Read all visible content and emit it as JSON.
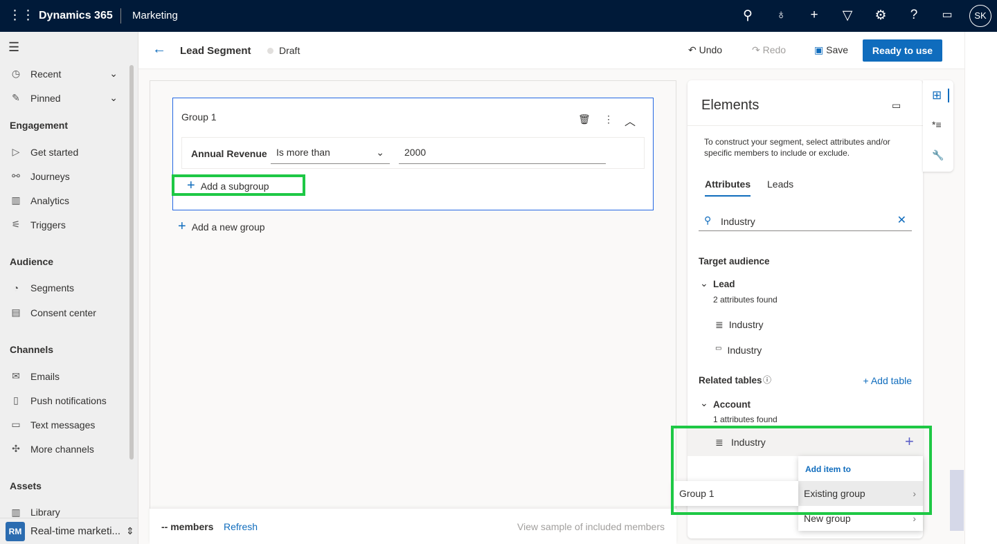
{
  "topbar": {
    "app": "Dynamics 365",
    "module": "Marketing",
    "avatar": "SK",
    "icons": [
      "search-icon",
      "lightbulb-icon",
      "plus-icon",
      "filter-icon",
      "gear-icon",
      "help-icon",
      "chat-icon"
    ]
  },
  "sidebar": {
    "recent": "Recent",
    "pinned": "Pinned",
    "sections": [
      {
        "title": "Engagement",
        "items": [
          "Get started",
          "Journeys",
          "Analytics",
          "Triggers"
        ]
      },
      {
        "title": "Audience",
        "items": [
          "Segments",
          "Consent center"
        ]
      },
      {
        "title": "Channels",
        "items": [
          "Emails",
          "Push notifications",
          "Text messages",
          "More channels"
        ]
      },
      {
        "title": "Assets",
        "items": [
          "Library"
        ]
      }
    ],
    "area_badge": "RM",
    "area_name": "Real-time marketi..."
  },
  "header": {
    "title": "Lead Segment",
    "status": "Draft",
    "undo": "Undo",
    "redo": "Redo",
    "save": "Save",
    "ready": "Ready to use"
  },
  "group": {
    "title": "Group 1",
    "attribute": "Annual Revenue",
    "operator": "Is more than",
    "value": "2000",
    "add_subgroup": "Add a subgroup"
  },
  "add_group": "Add a new group",
  "footer": {
    "members": "-- members",
    "refresh": "Refresh",
    "sample": "View sample of included members"
  },
  "elements": {
    "title": "Elements",
    "description": "To construct your segment, select attributes and/or specific members to include or exclude.",
    "tabs": [
      "Attributes",
      "Leads"
    ],
    "search": "Industry",
    "target_audience": "Target audience",
    "lead": "Lead",
    "lead_found": "2 attributes found",
    "lead_attrs": [
      "Industry",
      "Industry"
    ],
    "related_tables": "Related tables",
    "add_table": "+ Add table",
    "account": "Account",
    "account_found": "1 attributes found",
    "account_attr": "Industry"
  },
  "menu": {
    "header": "Add item to",
    "existing": "Existing group",
    "new": "New group",
    "submenu_item": "Group 1"
  }
}
